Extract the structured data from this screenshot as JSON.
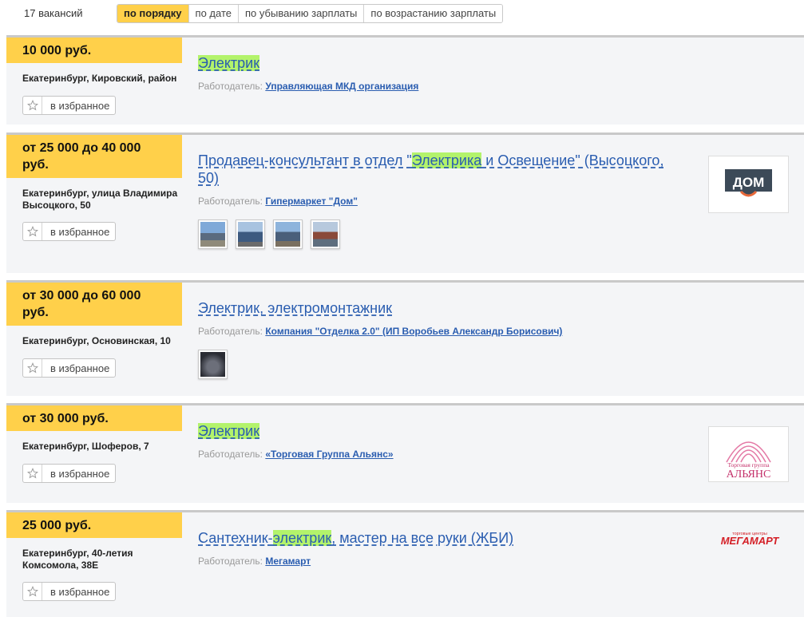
{
  "vacancy_count": "17 вакансий",
  "sort_options": [
    "по порядку",
    "по дате",
    "по убыванию зарплаты",
    "по возрастанию зарплаты"
  ],
  "sort_active": "по порядку",
  "employer_prefix": "Работодатель:",
  "favorite_label": "в избранное",
  "vacancies": [
    {
      "salary": "10 000 руб.",
      "location": "Екатеринбург, Кировский, район",
      "title_parts": [
        "",
        "Электрик",
        ""
      ],
      "employer": "Управляющая МКД организация"
    },
    {
      "salary": "от 25 000 до 40 000 руб.",
      "location": "Екатеринбург, улица Владимира Высоцкого, 50",
      "title_parts": [
        "Продавец-консультант в отдел \"",
        "Электрика",
        " и Освещение\" (Высоцкого, 50)"
      ],
      "employer": "Гипермаркет \"Дом\"",
      "logo_text": "ДОМ"
    },
    {
      "salary": "от 30 000 до 60 000 руб.",
      "location": "Екатеринбург, Основинская, 10",
      "title_parts": [
        "Электрик, электромонтажник",
        "",
        ""
      ],
      "employer": "Компания \"Отделка 2.0\" (ИП Воробьев Александр Борисович)"
    },
    {
      "salary": "от 30 000 руб.",
      "location": "Екатеринбург, Шоферов, 7",
      "title_parts": [
        "",
        "Электрик",
        ""
      ],
      "employer": "«Торговая Группа Альянс»",
      "logo_text_small": "Торговая группа",
      "logo_text_big": "АЛЬЯНС"
    },
    {
      "salary": "25 000 руб.",
      "location": "Екатеринбург, 40-летия Комсомола, 38Е",
      "title_parts": [
        "Сантехник-",
        "электрик",
        ", мастер на все руки (ЖБИ)"
      ],
      "employer": "Мегамарт",
      "logo_text_small": "торговые центры",
      "logo_text_big": "МЕГАМАРТ"
    }
  ],
  "colors": {
    "salary_bg": "#ffd04a",
    "link": "#2a5db0",
    "highlight": "#b3f36b",
    "card_bg": "#f4f5f7"
  }
}
